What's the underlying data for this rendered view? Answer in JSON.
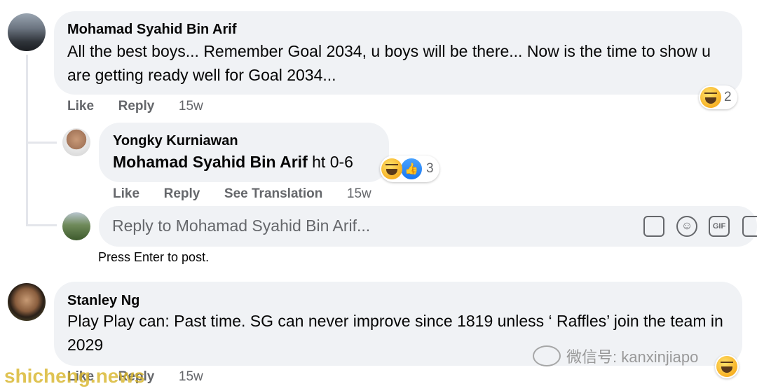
{
  "comments": [
    {
      "author": "Mohamad Syahid Bin Arif",
      "text": "All the best boys... Remember Goal 2034, u boys will be there... Now is the time to show u are getting ready well for Goal 2034...",
      "reaction_count": "2",
      "like": "Like",
      "reply": "Reply",
      "time": "15w"
    },
    {
      "author": "Stanley Ng",
      "text": "Play Play can: Past time. SG can never improve since 1819 unless ‘ Raffles’ join the team in 2029",
      "like": "Like",
      "reply": "Reply",
      "time": "15w"
    }
  ],
  "reply": {
    "author": "Yongky Kurniawan",
    "mention": "Mohamad Syahid Bin Arif",
    "text": "ht 0-6",
    "reaction_count": "3",
    "like": "Like",
    "reply": "Reply",
    "see_translation": "See Translation",
    "time": "15w"
  },
  "reply_input": {
    "placeholder": "Reply to Mohamad Syahid Bin Arif...",
    "hint": "Press Enter to post.",
    "gif_label": "GIF"
  },
  "watermarks": {
    "wechat": "微信号: kanxinjiapo",
    "site": "shicheng.news"
  }
}
